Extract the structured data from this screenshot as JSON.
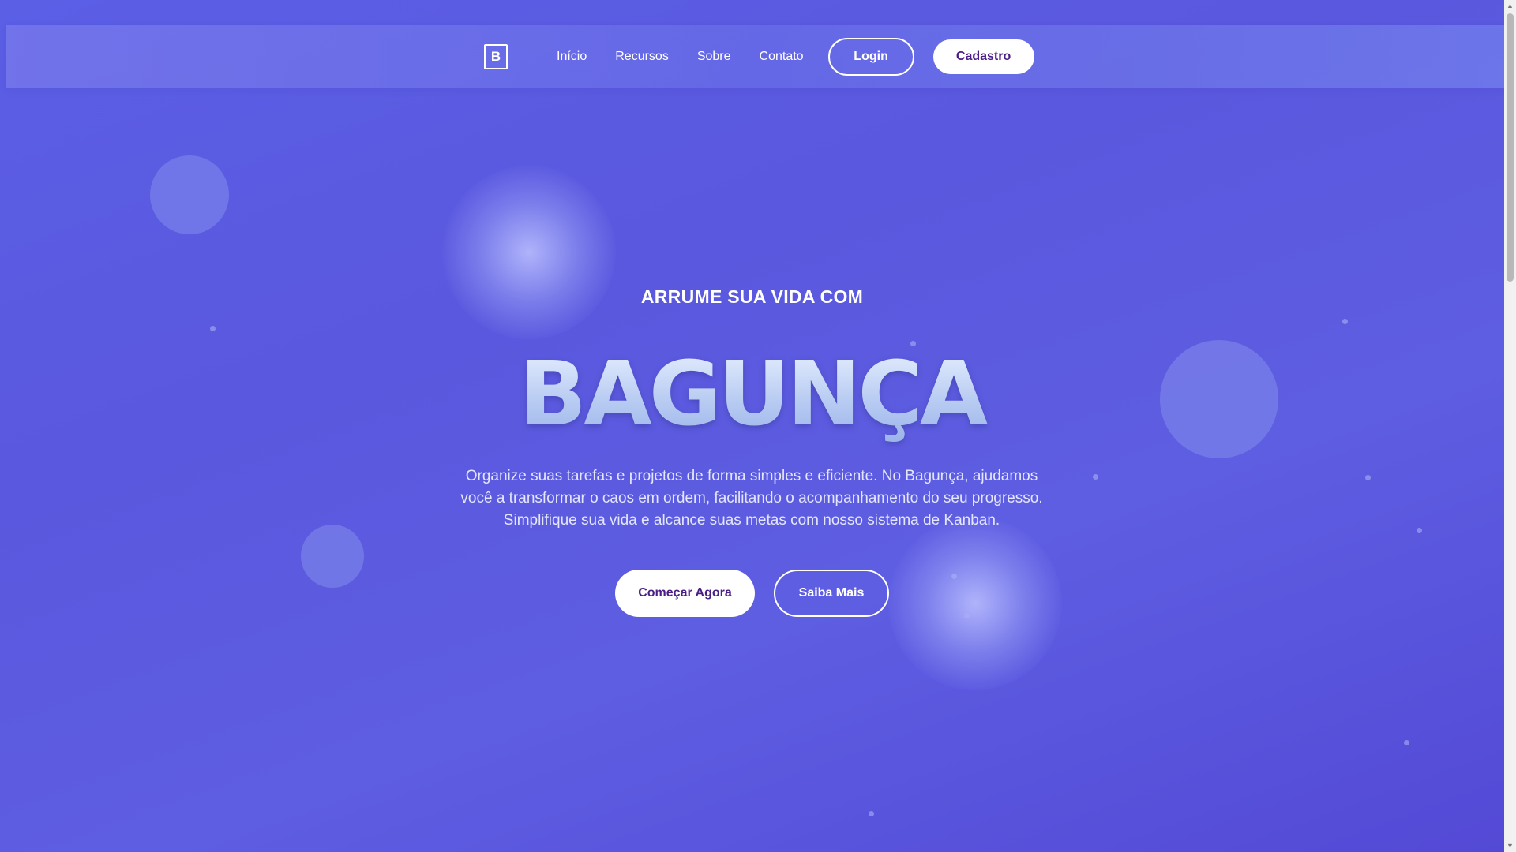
{
  "header": {
    "logo_letter": "B",
    "nav": {
      "home": "Início",
      "features": "Recursos",
      "about": "Sobre",
      "contact": "Contato"
    },
    "login_label": "Login",
    "signup_label": "Cadastro"
  },
  "hero": {
    "eyebrow": "ARRUME SUA VIDA COM",
    "headline": "BAGUNÇA",
    "description": "Organize suas tarefas e projetos de forma simples e eficiente. No Bagunça, ajudamos você a transformar o caos em ordem, facilitando o acompanhamento do seu progresso. Simplifique sua vida e alcance suas metas com nosso sistema de Kanban.",
    "primary_cta": "Começar Agora",
    "secondary_cta": "Saiba Mais"
  },
  "theme": {
    "background": "#5b5ce2",
    "accent_text": "#4b1e86",
    "headline_color": "#b4caf0"
  },
  "scrollbar": {
    "up_icon": "scroll-up-arrow-icon",
    "down_icon": "scroll-down-arrow-icon"
  }
}
